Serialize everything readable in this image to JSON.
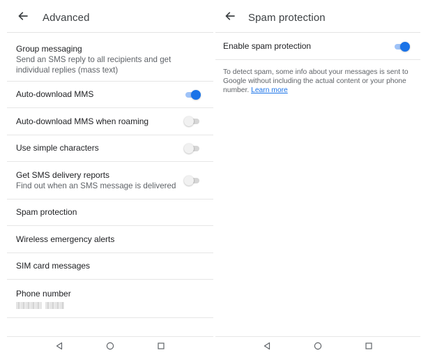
{
  "advanced": {
    "title": "Advanced",
    "rows": [
      {
        "title": "Group messaging",
        "subtitle": "Send an SMS reply to all recipients and get individual replies (mass text)"
      },
      {
        "title": "Auto-download MMS",
        "toggle": "on"
      },
      {
        "title": "Auto-download MMS when roaming",
        "toggle": "off"
      },
      {
        "title": "Use simple characters",
        "toggle": "off"
      },
      {
        "title": "Get SMS delivery reports",
        "subtitle": "Find out when an SMS message is delivered",
        "toggle": "off"
      },
      {
        "title": "Spam protection"
      },
      {
        "title": "Wireless emergency alerts"
      },
      {
        "title": "SIM card messages"
      },
      {
        "title": "Phone number",
        "subtitle": "[redacted]"
      }
    ]
  },
  "spam_protection": {
    "title": "Spam protection",
    "enable_label": "Enable spam protection",
    "enable_toggle": "on",
    "info_text": "To detect spam, some info about your messages is sent to Google without including the actual content or your phone number.",
    "learn_more": "Learn more"
  },
  "icons": {
    "back": "arrow-back-icon",
    "nav": [
      "nav-back-icon",
      "nav-home-icon",
      "nav-recents-icon"
    ]
  },
  "colors": {
    "accent": "#1a73e8",
    "toggle_on_track": "#9fc3f8",
    "toggle_off_track": "#d6d6d6",
    "divider": "#e6e6e6",
    "secondary_text": "#5f6368"
  }
}
